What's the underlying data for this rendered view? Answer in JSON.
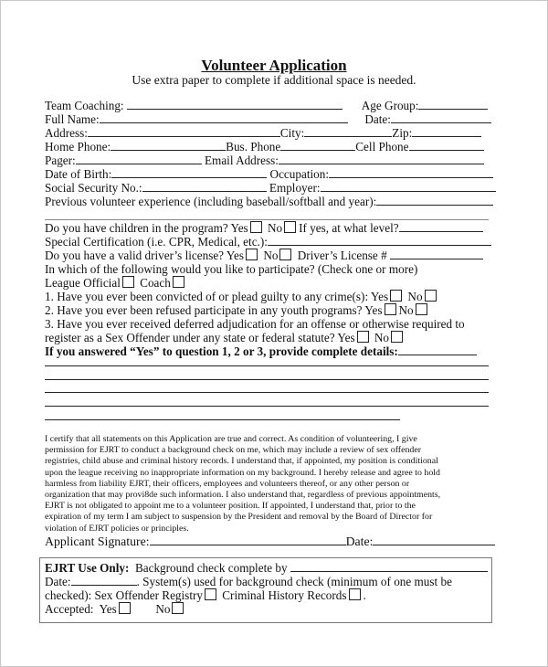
{
  "document": {
    "title": "Volunteer Application",
    "subtitle": "Use extra paper to complete if additional space is needed."
  },
  "fields": {
    "team_coaching": "Team Coaching:",
    "age_group": "Age Group:",
    "full_name": "Full Name:",
    "date": "Date:",
    "address": "Address:",
    "city": "City:",
    "zip": "Zip:",
    "home_phone": "Home Phone:",
    "bus_phone": "Bus. Phone",
    "cell_phone": "Cell Phone",
    "pager": "Pager:",
    "email": "Email Address:",
    "dob": "Date of Birth:",
    "occupation": "Occupation:",
    "ssn": "Social Security No.:",
    "employer": "Employer:",
    "prev_experience": "Previous volunteer experience (including baseball/softball and year):"
  },
  "questions": {
    "children": "Do you have children in the program?",
    "children_level": "If yes, at what level?",
    "certification": "Special Certification (i.e. CPR, Medical, etc.):",
    "license": "Do you have a valid driver’s license?",
    "license_no": "Driver’s License #",
    "participate": "In which of the following would you like to participate? (Check one or more)",
    "league_official": "League Official",
    "coach": "Coach",
    "q1": "1. Have you ever been convicted of or plead guilty to any crime(s):",
    "q2": "2. Have you ever been refused participate in any youth programs?",
    "q3a": "3. Have you ever received deferred adjudication for an offense or otherwise required to",
    "q3b": "register as a Sex Offender under any state or federal statute?",
    "details": "If you answered “Yes” to question 1, 2 or 3, provide complete details:",
    "yes": "Yes",
    "no": "No"
  },
  "certification_text": [
    "I certify that all statements on this Application are true and correct.  As condition of volunteering, I give",
    "permission for EJRT to conduct a background check on me, which may include a review of sex offender",
    "registries, child abuse and criminal history records.  I understand that, if appointed, my position is conditional",
    "upon the league receiving no inappropriate information on my background.  I hereby release and agree to hold",
    "harmless from liability EJRT, their officers, employees and volunteers thereof, or any other person or",
    "organization that may provi8de such information.  I also understand that, regardless of previous appointments,",
    "EJRT is not obligated to appoint me to a volunteer position.  If appointed, I understand that, prior to the",
    "expiration of my term I am subject to suspension by the President and removal by the Board of Director for",
    "violation of EJRT policies or principles."
  ],
  "signature": {
    "label": "Applicant Signature:",
    "date": "Date:"
  },
  "ejrt": {
    "heading": "EJRT Use Only:",
    "bg_check": "Background check complete by",
    "date": "Date:",
    "systems": ". System(s) used for background check (minimum of one must be",
    "checked": "checked): Sex Offender Registry",
    "criminal": "Criminal History Records",
    "period": ".",
    "accepted": "Accepted:",
    "yes": "Yes",
    "no": "No"
  }
}
